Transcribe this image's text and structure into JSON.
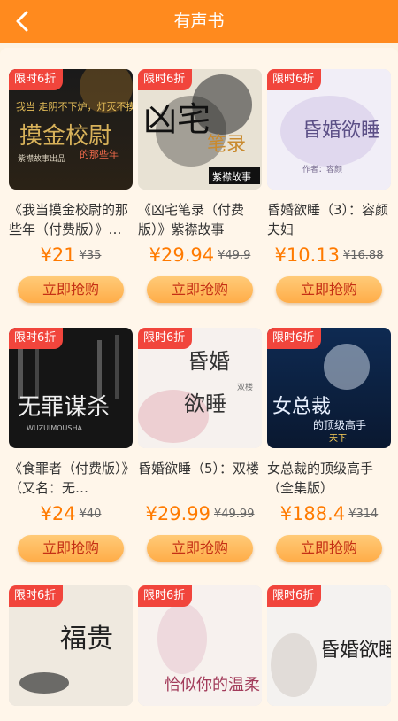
{
  "header": {
    "title": "有声书",
    "back_icon": "back-arrow-icon"
  },
  "colors": {
    "header": "#ff8a1e",
    "price": "#ff7a00",
    "badge": "#f1453c",
    "button": "#ffb553"
  },
  "products": [
    {
      "badge": "限时6折",
      "name": "《我当摸金校尉的那些年（付费版）》…",
      "price": "¥21",
      "original_price": "¥35",
      "button": "立即抢购",
      "cover_text": [
        "我当 走阴不下炉，灯灭不摸金",
        "摸金校尉",
        "紫襟故事出品",
        "的那些年"
      ]
    },
    {
      "badge": "限时6折",
      "name": "《凶宅笔录（付费版）》紫襟故事",
      "price": "¥29.94",
      "original_price": "¥49.9",
      "button": "立即抢购",
      "cover_text": [
        "凶宅",
        "笔录",
        "紫襟故事"
      ]
    },
    {
      "badge": "限时6折",
      "name": "昏婚欲睡（3）：容颜夫妇",
      "price": "¥10.13",
      "original_price": "¥16.88",
      "button": "立即抢购",
      "cover_text": [
        "昏婚欲睡",
        "作者：容颜"
      ]
    },
    {
      "badge": "限时6折",
      "name": "《食罪者（付费版）》（又名：无…",
      "price": "¥24",
      "original_price": "¥40",
      "button": "立即抢购",
      "cover_text": [
        "无罪谋杀",
        "WUZUIMOUSHA"
      ]
    },
    {
      "badge": "限时6折",
      "name": "昏婚欲睡（5）：双楼",
      "price": "¥29.99",
      "original_price": "¥49.99",
      "button": "立即抢购",
      "cover_text": [
        "昏婚",
        "欲睡",
        "双楼"
      ]
    },
    {
      "badge": "限时6折",
      "name": "女总裁的顶级高手（全集版）",
      "price": "¥188.4",
      "original_price": "¥314",
      "button": "立即抢购",
      "cover_text": [
        "女总裁",
        "的顶级高手",
        "天下"
      ]
    },
    {
      "badge": "限时6折",
      "name": "",
      "price": "",
      "original_price": "",
      "button": "",
      "cover_text": [
        "福贵"
      ]
    },
    {
      "badge": "限时6折",
      "name": "",
      "price": "",
      "original_price": "",
      "button": "",
      "cover_text": [
        "恰似你的温柔"
      ]
    },
    {
      "badge": "限时6折",
      "name": "",
      "price": "",
      "original_price": "",
      "button": "",
      "cover_text": [
        "昏婚欲睡"
      ]
    }
  ]
}
